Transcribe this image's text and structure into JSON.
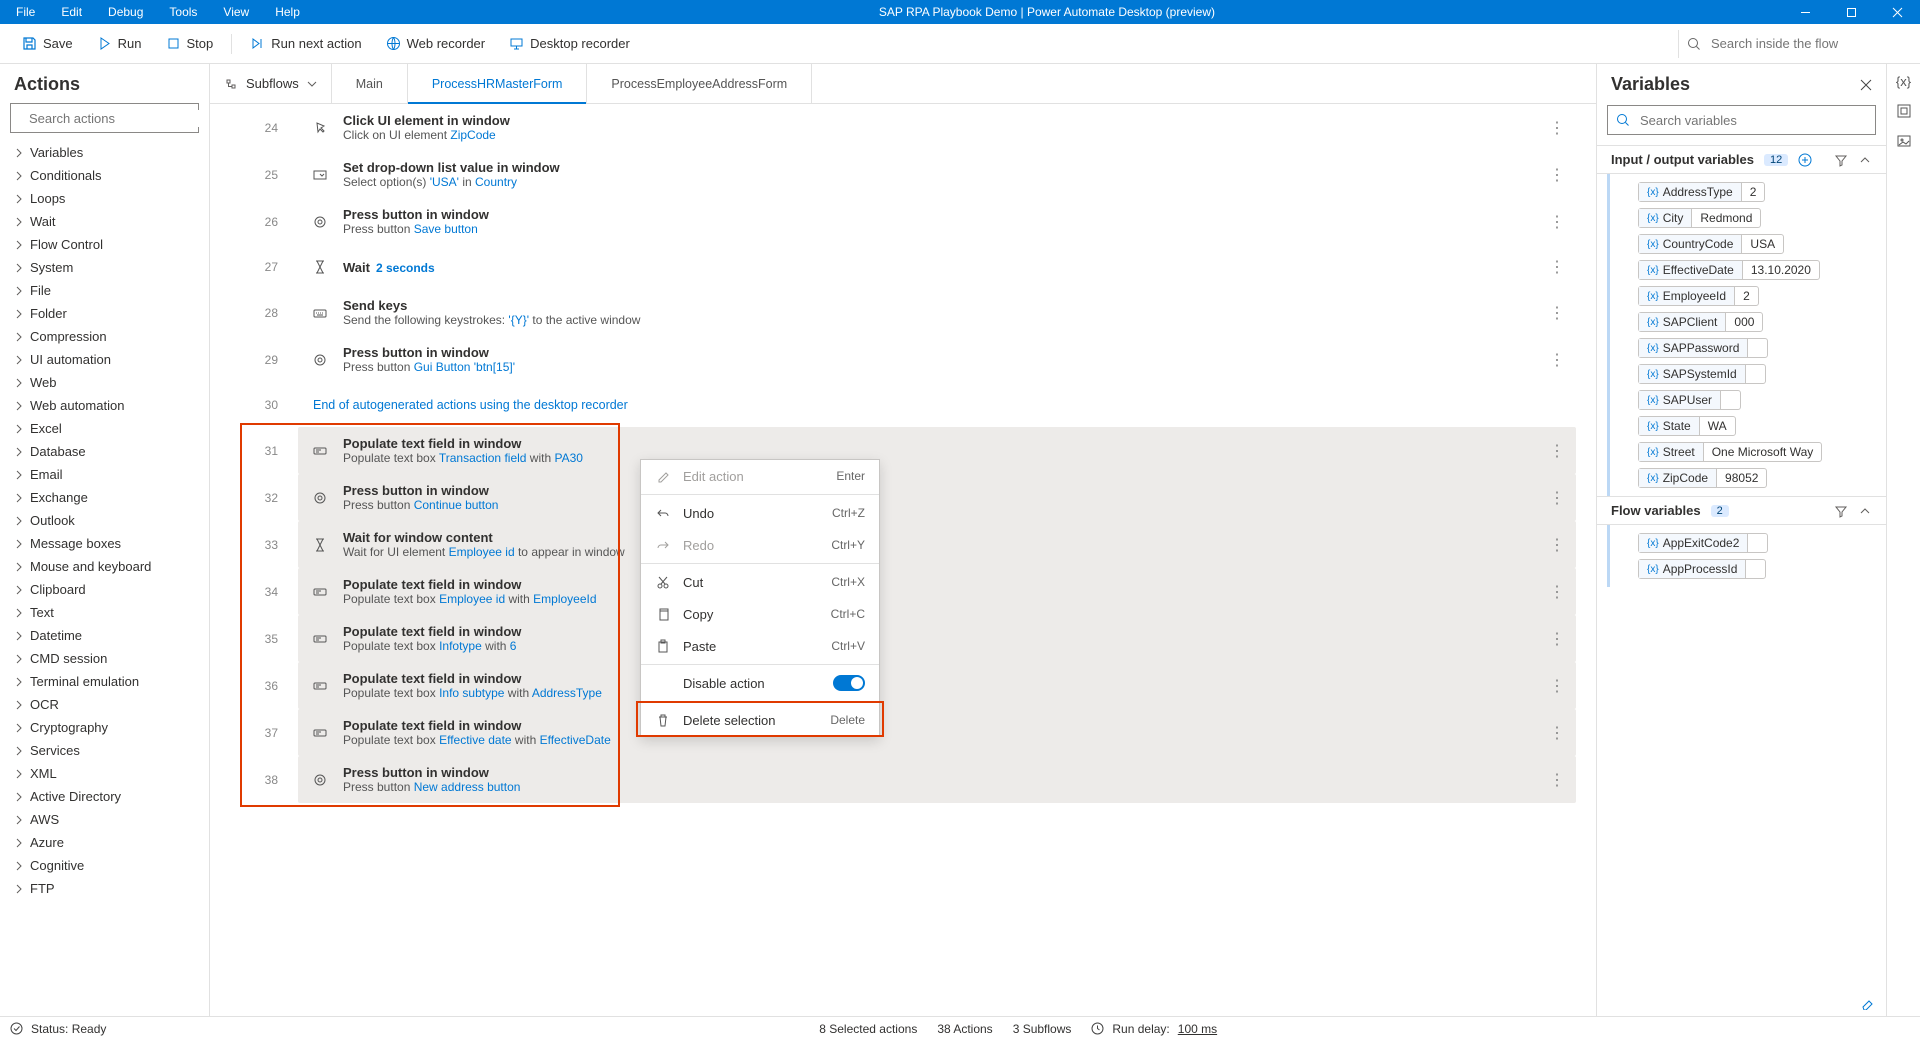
{
  "titlebar": {
    "menus": [
      "File",
      "Edit",
      "Debug",
      "Tools",
      "View",
      "Help"
    ],
    "title": "SAP RPA Playbook Demo | Power Automate Desktop (preview)"
  },
  "toolbar": {
    "save": "Save",
    "run": "Run",
    "stop": "Stop",
    "run_next": "Run next action",
    "web_rec": "Web recorder",
    "desk_rec": "Desktop recorder",
    "search_placeholder": "Search inside the flow"
  },
  "left": {
    "title": "Actions",
    "search_placeholder": "Search actions",
    "tree": [
      "Variables",
      "Conditionals",
      "Loops",
      "Wait",
      "Flow Control",
      "System",
      "File",
      "Folder",
      "Compression",
      "UI automation",
      "Web",
      "Web automation",
      "Excel",
      "Database",
      "Email",
      "Exchange",
      "Outlook",
      "Message boxes",
      "Mouse and keyboard",
      "Clipboard",
      "Text",
      "Datetime",
      "CMD session",
      "Terminal emulation",
      "OCR",
      "Cryptography",
      "Services",
      "XML",
      "Active Directory",
      "AWS",
      "Azure",
      "Cognitive",
      "FTP"
    ]
  },
  "subflows": {
    "label": "Subflows",
    "tabs": [
      "Main",
      "ProcessHRMasterForm",
      "ProcessEmployeeAddressForm"
    ],
    "active": 1
  },
  "steps": [
    {
      "n": "24",
      "icon": "click",
      "t": "Click UI element in window",
      "d": [
        "Click on UI element ",
        {
          "lk": "ZipCode"
        }
      ]
    },
    {
      "n": "25",
      "icon": "dropdown",
      "t": "Set drop-down list value in window",
      "d": [
        "Select option(s) ",
        {
          "lk": "'USA'"
        },
        " in ",
        {
          "lk": "Country"
        }
      ]
    },
    {
      "n": "26",
      "icon": "press",
      "t": "Press button in window",
      "d": [
        "Press button ",
        {
          "lk": "Save button"
        }
      ]
    },
    {
      "n": "27",
      "icon": "wait",
      "t": "Wait",
      "d": [
        {
          "lk": "2 seconds"
        }
      ],
      "inline": true
    },
    {
      "n": "28",
      "icon": "keys",
      "t": "Send keys",
      "d": [
        "Send the following keystrokes: ",
        {
          "lk": "'{Y}'"
        },
        " to the active window"
      ]
    },
    {
      "n": "29",
      "icon": "press",
      "t": "Press button in window",
      "d": [
        "Press button ",
        {
          "lk": "Gui Button 'btn[15]'"
        }
      ]
    },
    {
      "n": "30",
      "divider": "End of autogenerated actions using the desktop recorder"
    },
    {
      "n": "31",
      "sel": true,
      "icon": "text",
      "t": "Populate text field in window",
      "d": [
        "Populate text box ",
        {
          "lk": "Transaction field"
        },
        " with ",
        {
          "lk": "PA30"
        }
      ]
    },
    {
      "n": "32",
      "sel": true,
      "icon": "press",
      "t": "Press button in window",
      "d": [
        "Press button ",
        {
          "lk": "Continue button"
        }
      ]
    },
    {
      "n": "33",
      "sel": true,
      "icon": "wait",
      "t": "Wait for window content",
      "d": [
        "Wait for UI element ",
        {
          "lk": "Employee id"
        },
        " to appear in window"
      ]
    },
    {
      "n": "34",
      "sel": true,
      "icon": "text",
      "t": "Populate text field in window",
      "d": [
        "Populate text box ",
        {
          "lk": "Employee id"
        },
        " with   ",
        {
          "lk": "EmployeeId"
        }
      ]
    },
    {
      "n": "35",
      "sel": true,
      "icon": "text",
      "t": "Populate text field in window",
      "d": [
        "Populate text box ",
        {
          "lk": "Infotype"
        },
        " with ",
        {
          "lk": "6"
        }
      ]
    },
    {
      "n": "36",
      "sel": true,
      "icon": "text",
      "t": "Populate text field in window",
      "d": [
        "Populate text box ",
        {
          "lk": "Info subtype"
        },
        " with   ",
        {
          "lk": "AddressType"
        }
      ]
    },
    {
      "n": "37",
      "sel": true,
      "icon": "text",
      "t": "Populate text field in window",
      "d": [
        "Populate text box ",
        {
          "lk": "Effective date"
        },
        " with   ",
        {
          "lk": "EffectiveDate"
        }
      ]
    },
    {
      "n": "38",
      "sel": true,
      "icon": "press",
      "t": "Press button in window",
      "d": [
        "Press button ",
        {
          "lk": "New address button"
        }
      ]
    }
  ],
  "ctx": {
    "edit": "Edit action",
    "edit_sc": "Enter",
    "undo": "Undo",
    "undo_sc": "Ctrl+Z",
    "redo": "Redo",
    "redo_sc": "Ctrl+Y",
    "cut": "Cut",
    "cut_sc": "Ctrl+X",
    "copy": "Copy",
    "copy_sc": "Ctrl+C",
    "paste": "Paste",
    "paste_sc": "Ctrl+V",
    "disable": "Disable action",
    "delete": "Delete selection",
    "delete_sc": "Delete"
  },
  "right": {
    "title": "Variables",
    "search_placeholder": "Search variables",
    "io_title": "Input / output variables",
    "io_count": "12",
    "flow_title": "Flow variables",
    "flow_count": "2",
    "io": [
      {
        "k": "AddressType",
        "v": "2"
      },
      {
        "k": "City",
        "v": "Redmond"
      },
      {
        "k": "CountryCode",
        "v": "USA"
      },
      {
        "k": "EffectiveDate",
        "v": "13.10.2020"
      },
      {
        "k": "EmployeeId",
        "v": "2"
      },
      {
        "k": "SAPClient",
        "v": "000"
      },
      {
        "k": "SAPPassword",
        "v": ""
      },
      {
        "k": "SAPSystemId",
        "v": ""
      },
      {
        "k": "SAPUser",
        "v": ""
      },
      {
        "k": "State",
        "v": "WA"
      },
      {
        "k": "Street",
        "v": "One Microsoft Way"
      },
      {
        "k": "ZipCode",
        "v": "98052"
      }
    ],
    "flow": [
      {
        "k": "AppExitCode2",
        "v": ""
      },
      {
        "k": "AppProcessId",
        "v": ""
      }
    ]
  },
  "status": {
    "ready": "Status: Ready",
    "sel": "8 Selected actions",
    "actions": "38 Actions",
    "subflows": "3 Subflows",
    "run_delay_lbl": "Run delay:",
    "run_delay_val": "100 ms"
  }
}
